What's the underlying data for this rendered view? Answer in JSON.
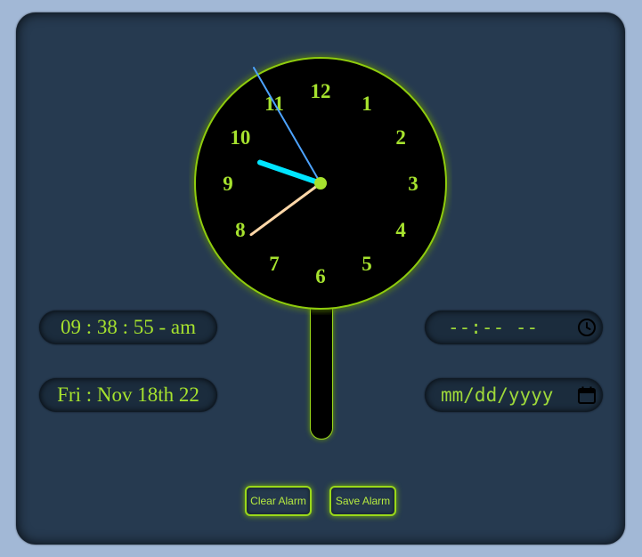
{
  "clock": {
    "numerals": [
      "12",
      "1",
      "2",
      "3",
      "4",
      "5",
      "6",
      "7",
      "8",
      "9",
      "10",
      "11"
    ],
    "time": {
      "hours": 9,
      "minutes": 38,
      "seconds": 55
    }
  },
  "time_display": "09 : 38 : 55 - am",
  "date_display": "Fri : Nov 18th 22",
  "alarm_time": {
    "placeholder": "--:-- --",
    "icon": "clock-icon"
  },
  "alarm_date": {
    "placeholder": "mm/dd/yyyy",
    "icon": "calendar-icon"
  },
  "buttons": {
    "clear": "Clear Alarm",
    "save": "Save Alarm"
  },
  "colors": {
    "accent": "#a6e22e",
    "panel": "#263a50",
    "background": "#a2b8d6",
    "hour_hand": "#00e5ff",
    "minute_hand": "#ffd7a8",
    "second_hand": "#4da3ff"
  }
}
